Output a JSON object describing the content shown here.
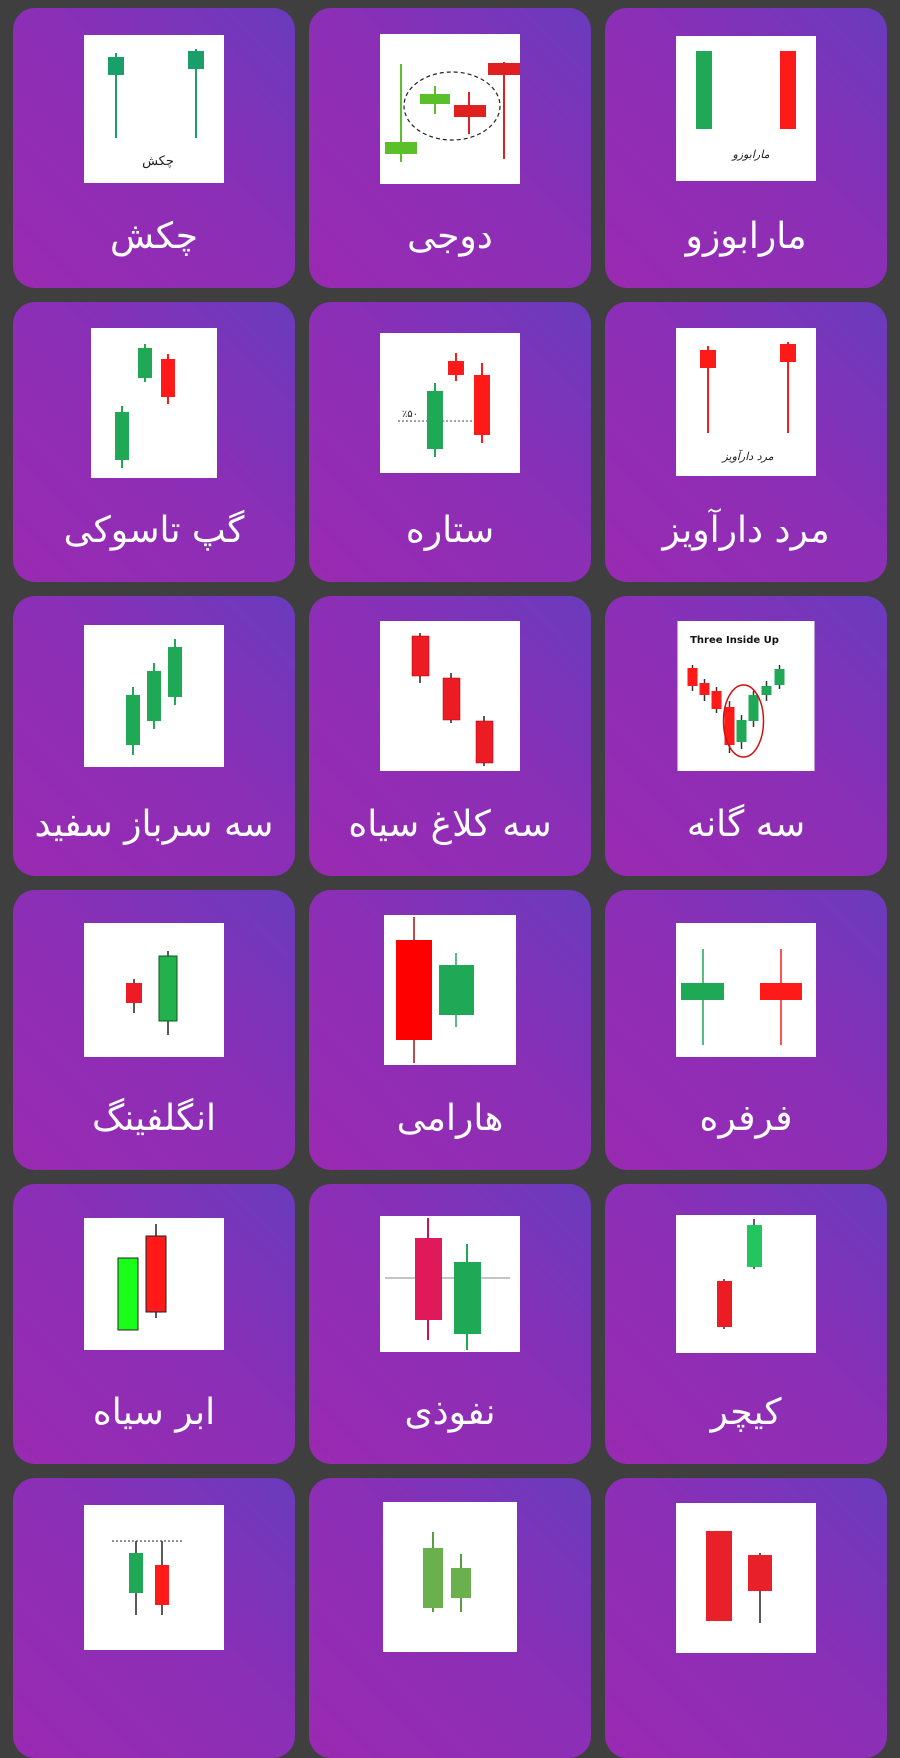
{
  "patterns": [
    {
      "title": "مارابوزو",
      "image_caption": "مارابوزو",
      "icon": "marubozu-chart-icon"
    },
    {
      "title": "دوجی",
      "image_caption": "",
      "icon": "doji-chart-icon"
    },
    {
      "title": "چکش",
      "image_caption": "چکش",
      "icon": "hammer-chart-icon"
    },
    {
      "title": "مرد دارآویز",
      "image_caption": "مرد دارآویز",
      "icon": "hanging-man-chart-icon"
    },
    {
      "title": "ستاره",
      "image_caption": "٪۵۰",
      "icon": "star-chart-icon"
    },
    {
      "title": "گپ تاسوکی",
      "image_caption": "",
      "icon": "tasuki-gap-chart-icon"
    },
    {
      "title": "سه گانه",
      "image_caption": "Three Inside Up",
      "icon": "three-inside-up-chart-icon"
    },
    {
      "title": "سه کلاغ سیاه",
      "image_caption": "",
      "icon": "three-black-crows-chart-icon"
    },
    {
      "title": "سه سرباز سفید",
      "image_caption": "",
      "icon": "three-white-soldiers-chart-icon"
    },
    {
      "title": "فرفره",
      "image_caption": "",
      "icon": "spinning-top-chart-icon"
    },
    {
      "title": "هارامی",
      "image_caption": "",
      "icon": "harami-chart-icon"
    },
    {
      "title": "انگلفینگ",
      "image_caption": "",
      "icon": "engulfing-chart-icon"
    },
    {
      "title": "کیچر",
      "image_caption": "",
      "icon": "kicker-chart-icon"
    },
    {
      "title": "نفوذی",
      "image_caption": "",
      "icon": "piercing-chart-icon"
    },
    {
      "title": "ابر سیاه",
      "image_caption": "",
      "icon": "dark-cloud-chart-icon"
    },
    {
      "title": "",
      "image_caption": "",
      "icon": "pattern-16-chart-icon"
    },
    {
      "title": "",
      "image_caption": "",
      "icon": "pattern-17-chart-icon"
    },
    {
      "title": "",
      "image_caption": "",
      "icon": "pattern-18-chart-icon"
    }
  ],
  "colors": {
    "background": "#3f3f3f",
    "card_gradient_start": "#6a3bbd",
    "card_gradient_end": "#9a2ab2",
    "bullish": "#1fa855",
    "bearish": "#ff1a1a",
    "label": "#ffffff"
  }
}
